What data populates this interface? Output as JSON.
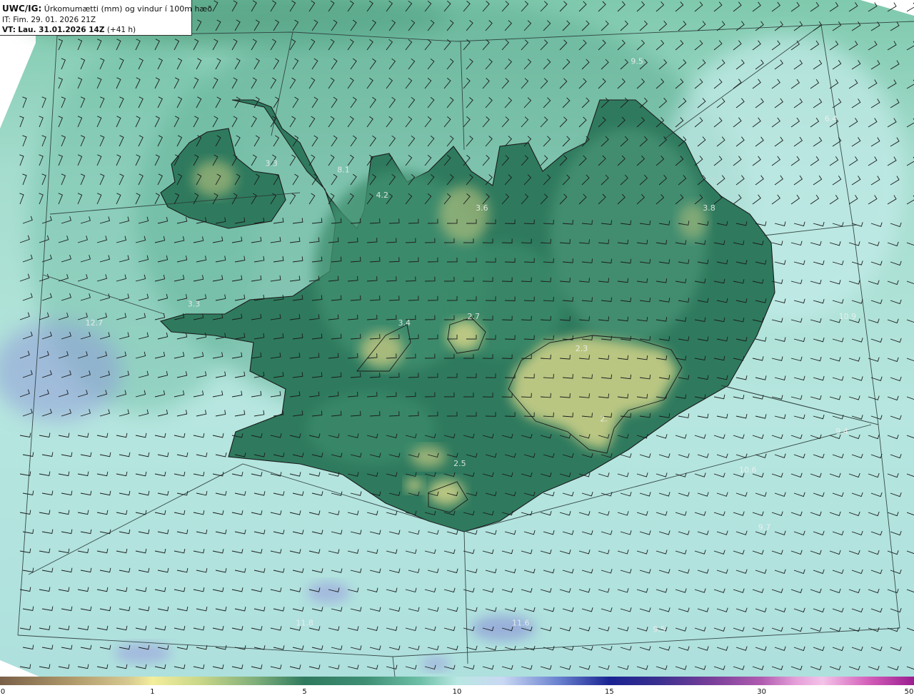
{
  "header": {
    "product": "UWC/IG:",
    "title": "Úrkomumætti (mm) og vindur í 100m hæð",
    "issue_label": "IT:",
    "issue_time": "Fim. 29. 01. 2026 21Z",
    "valid_label": "VT:",
    "valid_time": "Lau. 31.01.2026 14Z",
    "lead": "(+41 h)"
  },
  "colors": {
    "sea_light": "#b9e7e2",
    "land_dark": "#2f7a5e",
    "land_mid": "#4f9a7c",
    "dry": "#c9cf86",
    "wet_blue": "#8f9bd8",
    "coast": "#1a1a1a"
  },
  "map_labels": [
    {
      "id": "westfjords",
      "text": "3.3",
      "lon": -22.6,
      "lat": 66.0
    },
    {
      "id": "strandir",
      "text": "8.1",
      "lon": -21.3,
      "lat": 65.95
    },
    {
      "id": "hunafloi",
      "text": "4.2",
      "lon": -20.6,
      "lat": 65.75
    },
    {
      "id": "trollaskagi",
      "text": "3.6",
      "lon": -18.8,
      "lat": 65.65
    },
    {
      "id": "north-sea",
      "text": "9.5",
      "lon": -16.0,
      "lat": 66.8
    },
    {
      "id": "east-sea-ne",
      "text": "6.4",
      "lon": -12.5,
      "lat": 66.35
    },
    {
      "id": "austfirdir",
      "text": "3.8",
      "lon": -14.7,
      "lat": 65.65
    },
    {
      "id": "snaefellsnes",
      "text": "3.3",
      "lon": -24.0,
      "lat": 64.9
    },
    {
      "id": "west-sea",
      "text": "12.7",
      "lon": -25.8,
      "lat": 64.75
    },
    {
      "id": "langjokull",
      "text": "3.4",
      "lon": -20.2,
      "lat": 64.75
    },
    {
      "id": "hofsjokull",
      "text": "2.7",
      "lon": -18.95,
      "lat": 64.8
    },
    {
      "id": "vatnajokull",
      "text": "2.3",
      "lon": -17.0,
      "lat": 64.55
    },
    {
      "id": "oraefajokull",
      "text": "2.",
      "lon": -16.6,
      "lat": 64.0
    },
    {
      "id": "east-sea",
      "text": "10.9",
      "lon": -12.2,
      "lat": 64.8
    },
    {
      "id": "south-east-sea",
      "text": "10.6",
      "lon": -14.0,
      "lat": 63.6
    },
    {
      "id": "south-east-sea-2",
      "text": "9.4",
      "lon": -12.3,
      "lat": 63.9
    },
    {
      "id": "myrdalsjokull",
      "text": "2.5",
      "lon": -19.2,
      "lat": 63.65
    },
    {
      "id": "se-sea-far",
      "text": "9.7",
      "lon": -13.7,
      "lat": 63.15
    },
    {
      "id": "south-sea-1",
      "text": "11.8",
      "lon": -22.0,
      "lat": 62.4
    },
    {
      "id": "south-sea-2",
      "text": "11.6",
      "lon": -18.1,
      "lat": 62.4
    },
    {
      "id": "south-sea-3",
      "text": "9.5",
      "lon": -15.6,
      "lat": 62.35
    }
  ],
  "colorbar": {
    "ticks": [
      {
        "label": "0",
        "frac": 0.0
      },
      {
        "label": "1",
        "frac": 0.1667
      },
      {
        "label": "5",
        "frac": 0.3333
      },
      {
        "label": "10",
        "frac": 0.5
      },
      {
        "label": "15",
        "frac": 0.6667
      },
      {
        "label": "30",
        "frac": 0.8333
      },
      {
        "label": "50",
        "frac": 1.0
      }
    ]
  },
  "map_data": {
    "projection": "lambert-like",
    "lon_range": [
      -27.5,
      -11.0
    ],
    "lat_range": [
      62.0,
      67.3
    ],
    "wind_direction": "north-east/south-west barbs",
    "graticule_lons": [
      -24,
      -18,
      -12
    ],
    "graticule_lats": [
      63,
      64,
      66
    ]
  }
}
